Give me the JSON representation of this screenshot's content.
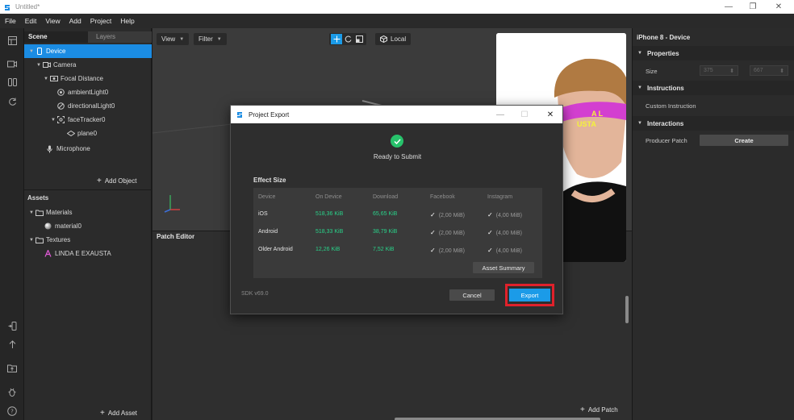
{
  "window": {
    "title": "Untitled*",
    "controls": {
      "minimize": "—",
      "maximize": "❐",
      "close": "✕"
    }
  },
  "menu": [
    "File",
    "Edit",
    "View",
    "Add",
    "Project",
    "Help"
  ],
  "scene_panel": {
    "tabs": [
      "Scene",
      "Layers"
    ],
    "tree": [
      {
        "label": "Device",
        "icon": "device-icon",
        "selected": true
      },
      {
        "label": "Camera",
        "icon": "camera-icon"
      },
      {
        "label": "Focal Distance",
        "icon": "focal-distance-icon"
      },
      {
        "label": "ambientLight0",
        "icon": "ambient-light-icon"
      },
      {
        "label": "directionalLight0",
        "icon": "directional-light-icon"
      },
      {
        "label": "faceTracker0",
        "icon": "face-tracker-icon"
      },
      {
        "label": "plane0",
        "icon": "plane-icon"
      },
      {
        "label": "Microphone",
        "icon": "microphone-icon"
      }
    ],
    "add_object": "Add Object",
    "assets_title": "Assets",
    "assets": [
      {
        "label": "Materials",
        "icon": "folder-icon"
      },
      {
        "label": "material0",
        "icon": "material-sphere-icon"
      },
      {
        "label": "Textures",
        "icon": "folder-icon"
      },
      {
        "label": "LINDA E EXAUSTA",
        "icon": "texture-icon"
      }
    ],
    "add_asset": "Add Asset"
  },
  "viewport": {
    "view_btn": "View",
    "filter_btn": "Filter",
    "local_btn": "Local",
    "preview_banner": "A L\nUSTA"
  },
  "patch_editor": {
    "title": "Patch Editor",
    "add_patch": "Add Patch"
  },
  "inspector": {
    "title": "iPhone 8 - Device",
    "properties": "Properties",
    "size_label": "Size",
    "size_w": "375",
    "size_h": "667",
    "instructions": "Instructions",
    "custom_instruction": "Custom Instruction",
    "interactions": "Interactions",
    "producer_patch": "Producer Patch",
    "create_btn": "Create"
  },
  "dialog": {
    "title": "Project Export",
    "status": "Ready to Submit",
    "section": "Effect Size",
    "columns": [
      "Device",
      "On Device",
      "Download",
      "Facebook",
      "Instagram"
    ],
    "rows": [
      {
        "device": "iOS",
        "on_device": "518,36 KiB",
        "download": "65,65 KiB",
        "facebook": "(2,00 MiB)",
        "instagram": "(4,00 MiB)"
      },
      {
        "device": "Android",
        "on_device": "518,33 KiB",
        "download": "38,79 KiB",
        "facebook": "(2,00 MiB)",
        "instagram": "(4,00 MiB)"
      },
      {
        "device": "Older Android",
        "on_device": "12,26 KiB",
        "download": "7,52 KiB",
        "facebook": "(2,00 MiB)",
        "instagram": "(4,00 MiB)"
      }
    ],
    "tick": "✓",
    "asset_summary": "Asset Summary",
    "sdk": "SDK v69.0",
    "cancel": "Cancel",
    "export": "Export"
  },
  "colors": {
    "accent": "#1b9be8",
    "selection": "#1b8ce3",
    "success": "#27c26b",
    "size_value": "#29d38a",
    "highlight_outline": "#e0212b"
  }
}
